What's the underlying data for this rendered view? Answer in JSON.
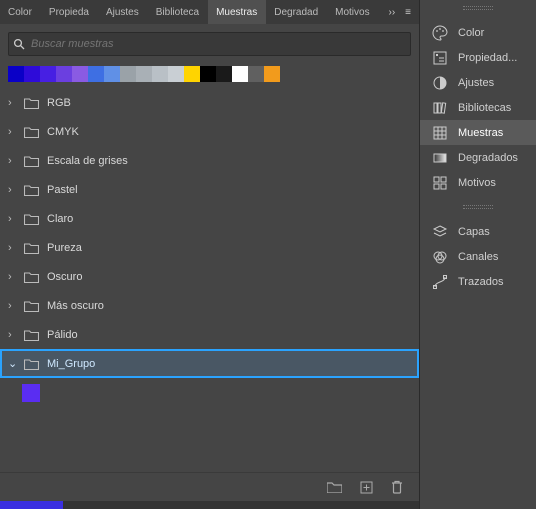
{
  "tabs": {
    "items": [
      "Color",
      "Propieda",
      "Ajustes",
      "Biblioteca",
      "Muestras",
      "Degradad",
      "Motivos"
    ],
    "active": 4,
    "expand_glyph": "››",
    "menu_glyph": "≡"
  },
  "search": {
    "placeholder": "Buscar muestras"
  },
  "swatches": [
    "#0a00c7",
    "#2e0bd9",
    "#471fe3",
    "#6b3fe0",
    "#8a5be3",
    "#3e6fe3",
    "#6090e6",
    "#9aa2a8",
    "#a9b0b6",
    "#b9c0c6",
    "#c9cfd4",
    "#ffd400",
    "#000000",
    "#1a1a1a",
    "#ffffff",
    "#606060",
    "#f29b1c"
  ],
  "folders": [
    {
      "label": "RGB"
    },
    {
      "label": "CMYK"
    },
    {
      "label": "Escala de grises"
    },
    {
      "label": "Pastel"
    },
    {
      "label": "Claro"
    },
    {
      "label": "Pureza"
    },
    {
      "label": "Oscuro"
    },
    {
      "label": "Más oscuro"
    },
    {
      "label": "Pálido"
    },
    {
      "label": "Mi_Grupo",
      "selected": true,
      "open": true,
      "child_color": "#5a2df2"
    }
  ],
  "side": {
    "group1": [
      {
        "icon": "palette",
        "label": "Color"
      },
      {
        "icon": "info",
        "label": "Propiedad..."
      },
      {
        "icon": "halfcircle",
        "label": "Ajustes"
      },
      {
        "icon": "books",
        "label": "Bibliotecas"
      },
      {
        "icon": "grid",
        "label": "Muestras",
        "active": true
      },
      {
        "icon": "gradient",
        "label": "Degradados"
      },
      {
        "icon": "pattern",
        "label": "Motivos"
      }
    ],
    "group2": [
      {
        "icon": "layers",
        "label": "Capas"
      },
      {
        "icon": "channels",
        "label": "Canales"
      },
      {
        "icon": "paths",
        "label": "Trazados"
      }
    ]
  },
  "bottom": {
    "folder": "new-group",
    "new": "new-swatch",
    "trash": "delete"
  }
}
